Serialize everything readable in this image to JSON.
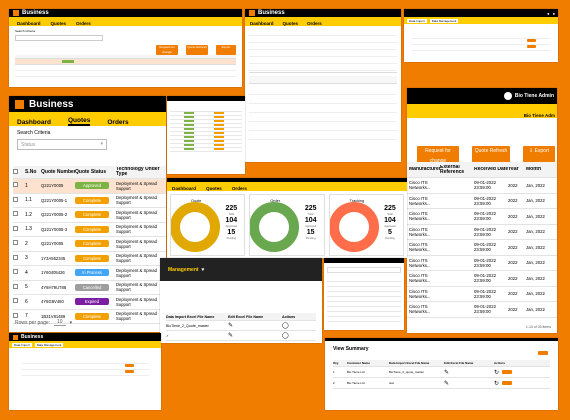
{
  "brand": {
    "name": "Business"
  },
  "nav": {
    "tabs": [
      "Dashboard",
      "Quotes",
      "Orders"
    ]
  },
  "search": {
    "label": "Search Criteria",
    "placeholder": "Status"
  },
  "actions": {
    "request_change": "Request for change",
    "quote_refresh": "Quote Refresh",
    "export": "Export"
  },
  "user": {
    "greeting": "Bio Tiene Admin",
    "greeting_short": "Bio Tiene Adm"
  },
  "table": {
    "headers": [
      "",
      "S.No",
      "Quote Number",
      "Quote Status",
      "Technology Under Type"
    ],
    "rows": [
      {
        "sno": "1",
        "quote": "Q221Y0005",
        "status": "Approved",
        "tech": "Deployment & Spread Support",
        "color": "#7cb342"
      },
      {
        "sno": "1.1",
        "quote": "Q221Y0005-1",
        "status": "Complete",
        "tech": "Deployment & Spread Support",
        "color": "#f2a000"
      },
      {
        "sno": "1.2",
        "quote": "Q221Y0005-2",
        "status": "Complete",
        "tech": "Deployment & Spread Support",
        "color": "#f2a000"
      },
      {
        "sno": "1.3",
        "quote": "Q221Y0005-3",
        "status": "Complete",
        "tech": "Deployment & Spread Support",
        "color": "#f2a000"
      },
      {
        "sno": "2",
        "quote": "Q221Y0005",
        "status": "Complete",
        "tech": "Deployment & Spread Support",
        "color": "#f2a000"
      },
      {
        "sno": "3",
        "quote": "1Y3A562345",
        "status": "Complete",
        "tech": "Deployment & Spread Support",
        "color": "#f2a000"
      },
      {
        "sno": "4",
        "quote": "1Y60405426",
        "status": "In Process",
        "tech": "Deployment & Spread Support",
        "color": "#42a5f5"
      },
      {
        "sno": "5",
        "quote": "4Y8H79U786",
        "status": "Cancelled",
        "tech": "Deployment & Spread Support",
        "color": "#9e9e9e"
      },
      {
        "sno": "6",
        "quote": "4Y8G8V460",
        "status": "Expired",
        "tech": "Deployment & Spread Support",
        "color": "#7b1fa2"
      },
      {
        "sno": "7",
        "quote": "1B31V81489",
        "status": "Complete",
        "tech": "Deployment & Spread Support",
        "color": "#f2a000"
      }
    ],
    "rows_per_page_label": "Rows per page:",
    "rows_per_page": "10"
  },
  "right_table": {
    "headers": [
      "Manufacturer",
      "External Reference",
      "Received Date",
      "Year",
      "Month"
    ],
    "rows": [
      [
        "Cisco ITS Networks...",
        "",
        "09-01-2022 23:59:00",
        "2022",
        "Jan, 2022"
      ],
      [
        "Cisco ITS Networks...",
        "",
        "09-01-2022 23:59:00",
        "2022",
        "Jan, 2022"
      ],
      [
        "Cisco ITS Networks...",
        "",
        "09-01-2022 23:59:00",
        "2022",
        "Jan, 2022"
      ],
      [
        "Cisco ITS Networks...",
        "",
        "09-01-2022 23:59:00",
        "2022",
        "Jan, 2022"
      ],
      [
        "Cisco ITS Networks...",
        "",
        "09-01-2022 23:59:00",
        "2022",
        "Jan, 2022"
      ],
      [
        "Cisco ITS Networks...",
        "",
        "09-01-2022 23:59:00",
        "2022",
        "Jan, 2022"
      ],
      [
        "Cisco ITS Networks...",
        "",
        "09-01-2022 23:59:00",
        "2022",
        "Jan, 2022"
      ],
      [
        "Cisco ITS Networks...",
        "",
        "09-01-2022 23:59:00",
        "2022",
        "Jan, 2022"
      ],
      [
        "Cisco ITS Networks...",
        "",
        "09-01-2022 23:59:00",
        "2022",
        "Jan, 2022"
      ]
    ],
    "pagination": "1-10 of 30 items"
  },
  "dashboard": {
    "cards": [
      {
        "title": "Quote",
        "color": "#e0a800",
        "stats": [
          "225",
          "104",
          "15"
        ],
        "labels": [
          "Total",
          "Approved",
          "Pending"
        ]
      },
      {
        "title": "Order",
        "color": "#6aa84f",
        "stats": [
          "225",
          "104",
          "15"
        ],
        "labels": [
          "Total",
          "Approved",
          "Pending"
        ]
      },
      {
        "title": "Tracking",
        "color": "#ff6d4a",
        "stats": [
          "225",
          "104",
          "5"
        ],
        "labels": [
          "Total",
          "Approved",
          "Pending"
        ]
      }
    ]
  },
  "management": {
    "title": "Management",
    "headers": [
      "Data Import Excel File Name",
      "Edit Excel File Name",
      "Actions"
    ],
    "rows": [
      {
        "name": "BioTiene_2_Quote_master"
      },
      {
        "name": ""
      }
    ]
  },
  "view_summary": {
    "title": "View Summary",
    "headers": [
      "Org",
      "Customer Name",
      "Data Import Excel File Name",
      "Edit Excel File Name",
      "Actions"
    ],
    "rows": [
      {
        "org": "1",
        "cust": "Bio Tiene Ltd",
        "file": "BioTiene_2_quote_master"
      },
      {
        "org": "2",
        "cust": "Bio Tiene Ltd",
        "file": "test"
      }
    ]
  },
  "small_tabs": [
    "Data Import",
    "Data Management"
  ]
}
